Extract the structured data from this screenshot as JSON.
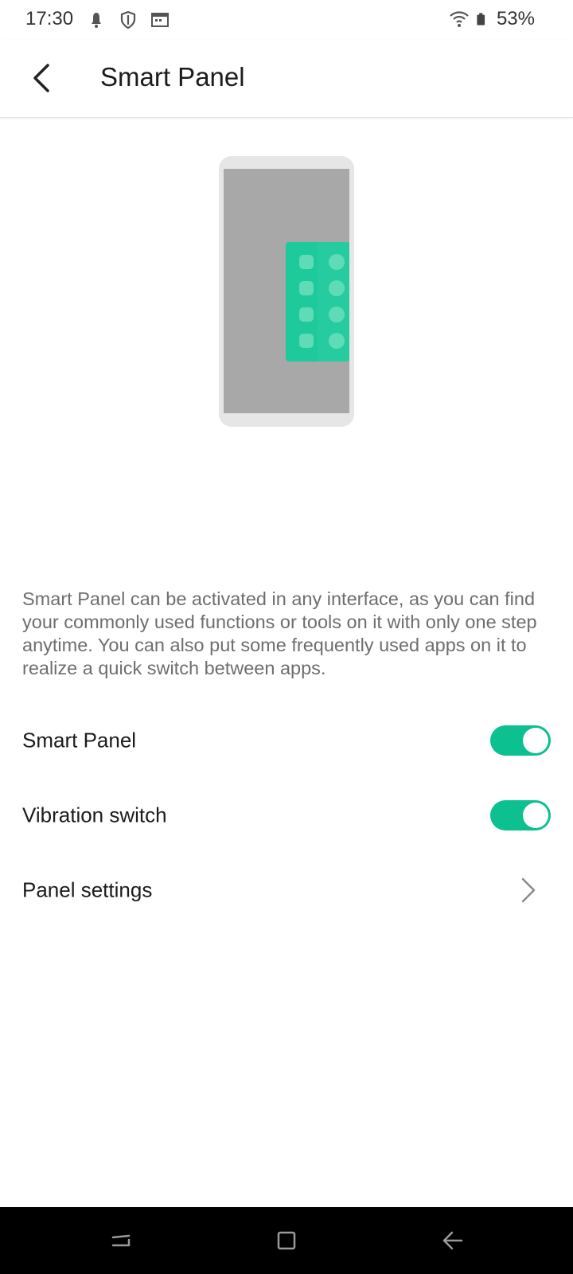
{
  "status_bar": {
    "time": "17:30",
    "battery_percent": "53%",
    "icons": [
      "notification-icon",
      "shield-icon",
      "calendar-icon",
      "wifi-icon",
      "battery-icon"
    ]
  },
  "app_bar": {
    "title": "Smart Panel",
    "back_icon": "back-arrow-icon"
  },
  "illustration": {
    "accent_color": "#1ec99b",
    "screen_color": "#a8a8a8",
    "frame_color": "#e6e6e6"
  },
  "description": "Smart Panel can be activated in any interface, as you can find your commonly used functions or tools on it with only one step anytime. You can also put some frequently used apps on it to realize a quick switch between apps.",
  "settings": {
    "smart_panel": {
      "label": "Smart Panel",
      "enabled": true
    },
    "vibration_switch": {
      "label": "Vibration switch",
      "enabled": true
    },
    "panel_settings": {
      "label": "Panel settings"
    }
  },
  "colors": {
    "toggle_on": "#0cc08f",
    "description_text": "#6e6e6e",
    "nav_bar": "#000000"
  },
  "nav_bar": {
    "buttons": [
      "recents-icon",
      "home-icon",
      "back-icon"
    ]
  }
}
